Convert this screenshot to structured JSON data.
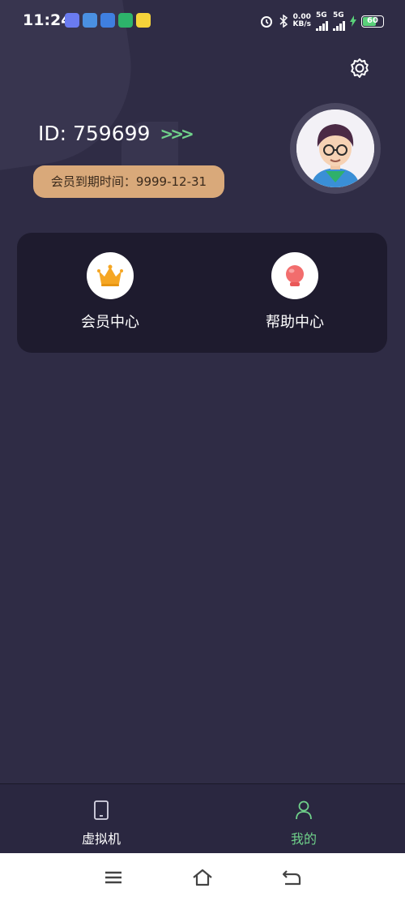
{
  "status_bar": {
    "time": "11:24",
    "net_speed": "0.00",
    "net_unit": "KB/s",
    "sim1": "5G",
    "sim2": "5G",
    "battery": "60"
  },
  "profile": {
    "id_text": "ID: 759699",
    "arrows": ">>>",
    "vip_expiry": "会员到期时间：9999-12-31"
  },
  "menu": {
    "items": [
      {
        "label": "会员中心",
        "icon": "crown-icon"
      },
      {
        "label": "帮助中心",
        "icon": "lightbulb-icon"
      }
    ]
  },
  "tabbar": {
    "items": [
      {
        "label": "虚拟机",
        "icon": "phone-icon",
        "active": false
      },
      {
        "label": "我的",
        "icon": "person-icon",
        "active": true
      }
    ]
  },
  "colors": {
    "background": "#2f2c45",
    "card": "#1e1b2e",
    "accent": "#6fd18a",
    "vip_badge": "#d9a97a"
  }
}
